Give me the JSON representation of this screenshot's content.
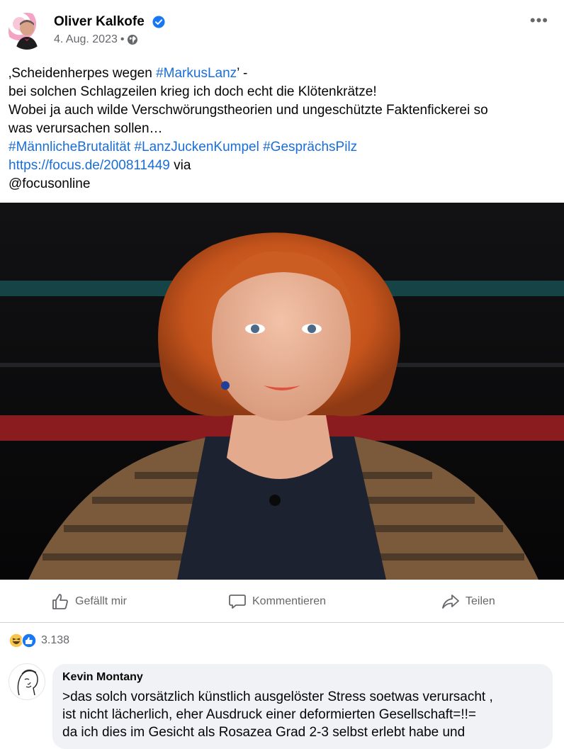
{
  "post": {
    "author": "Oliver Kalkofe",
    "date": "4. Aug. 2023",
    "separator": "•",
    "more_label": "•••",
    "text": {
      "l1_a": "‚Scheidenherpes wegen ",
      "l1_tag": "#MarkusLanz",
      "l1_b": "’ -",
      "l2": "bei solchen Schlagzeilen krieg ich doch echt die Klötenkrätze!",
      "l3": "Wobei ja auch wilde Verschwörungstheorien und ungeschützte Faktenfickerei so",
      "l4": "was verursachen sollen…",
      "tag1": "#MännlicheBrutalität",
      "tag2": "#LanzJuckenKumpel",
      "tag3": "#GesprächsPilz",
      "url": "https://focus.de/200811449",
      "via": " via",
      "mention": "@focusonline"
    }
  },
  "actions": {
    "like": "Gefällt mir",
    "comment": "Kommentieren",
    "share": "Teilen"
  },
  "reactions": {
    "count": "3.138",
    "types": [
      "haha-icon",
      "like-icon"
    ]
  },
  "comment": {
    "author": "Kevin Montany",
    "line1": ">das solch vorsätzlich künstlich ausgelöster Stress soetwas verursacht ,",
    "line2": "ist nicht lächerlich, eher Ausdruck einer deformierten  Gesellschaft=!!=",
    "line3": "da ich dies im Gesicht als Rosazea Grad 2-3 selbst erlebt habe und"
  },
  "colors": {
    "link": "#1a6ed8",
    "verified": "#1877f2",
    "secondary_text": "#65676b",
    "comment_bg": "#f0f2f5"
  }
}
